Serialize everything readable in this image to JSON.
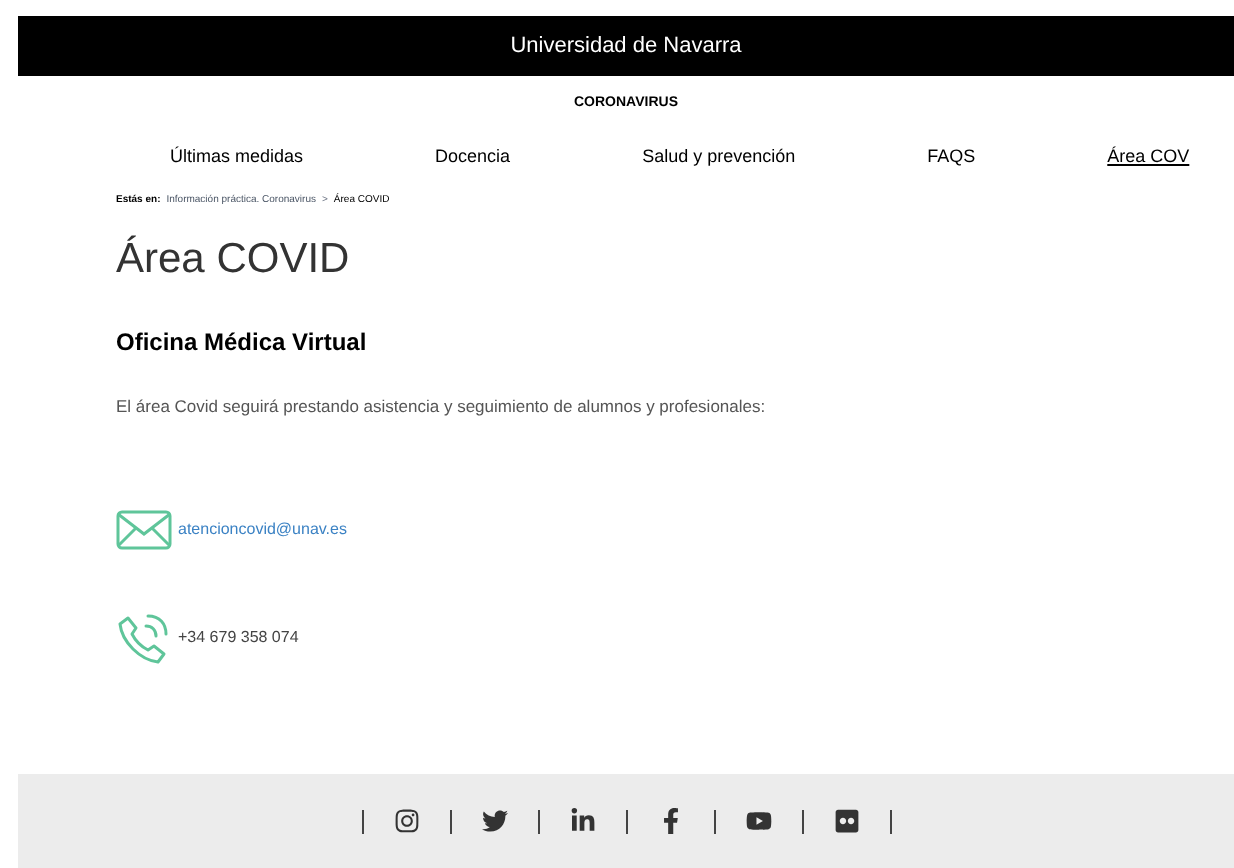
{
  "header": {
    "title": "Universidad de Navarra"
  },
  "section_label": "CORONAVIRUS",
  "nav": [
    {
      "label": "Últimas medidas",
      "selected": false
    },
    {
      "label": "Docencia",
      "selected": false
    },
    {
      "label": "Salud y prevención",
      "selected": false
    },
    {
      "label": "FAQS",
      "selected": false
    },
    {
      "label": "Área COV",
      "selected": true
    }
  ],
  "breadcrumb": {
    "prefix": "Estás en:",
    "items": [
      "Información práctica. Coronavirus",
      "Área COVID"
    ],
    "separator": ">"
  },
  "title": "Área COVID",
  "subtitle": "Oficina Médica Virtual",
  "paragraph": "El área Covid seguirá prestando asistencia y seguimiento de alumnos y profesionales:",
  "contacts": [
    {
      "kind": "email",
      "text": "atencioncovid@unav.es"
    },
    {
      "kind": "phone",
      "text": "+34 679 358 074"
    }
  ]
}
